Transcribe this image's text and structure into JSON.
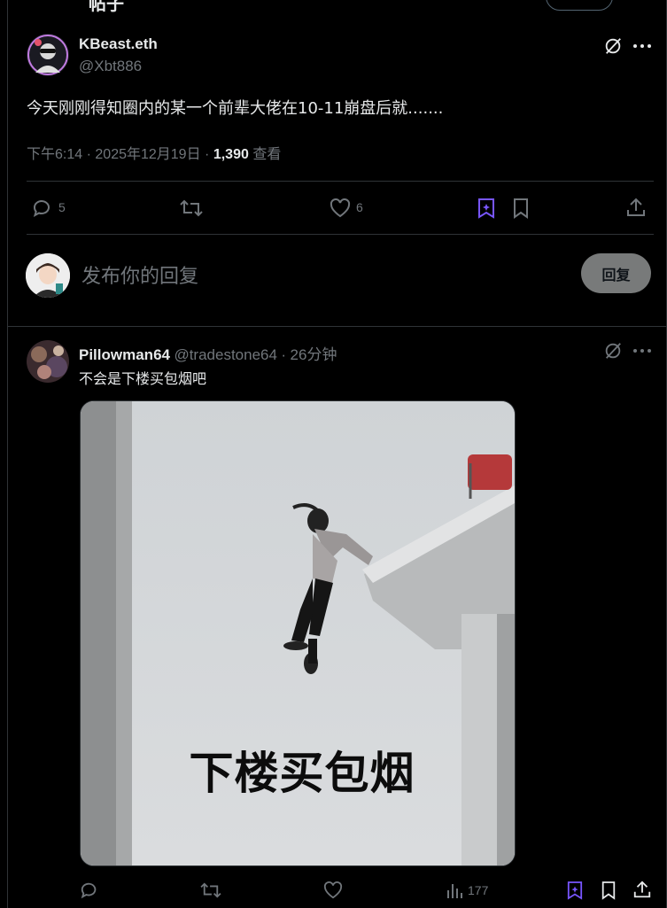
{
  "top_partial": {
    "text": "帖子"
  },
  "main_post": {
    "author_name": "KBeast.eth",
    "author_handle": "@Xbt886",
    "text": "今天刚刚得知圈内的某一个前辈大佬在10-11崩盘后就.......",
    "time": "下午6:14",
    "date": "2025年12月19日",
    "views": "1,390",
    "views_label": "查看",
    "replies_count": "5",
    "likes_count": "6",
    "icons": [
      "grok-icon",
      "more-icon",
      "reply-icon",
      "retweet-icon",
      "like-icon",
      "grok-sparkle-icon",
      "bookmark-icon",
      "share-icon"
    ]
  },
  "composer": {
    "placeholder": "发布你的回复",
    "button_label": "回复"
  },
  "reply_post": {
    "author_name": "Pillowman64",
    "author_handle": "@tradestone64",
    "time_ago": "26分钟",
    "text": "不会是下楼买包烟吧",
    "image_caption": "下楼买包烟",
    "views_count": "177"
  },
  "colors": {
    "background": "#000000",
    "text_primary": "#e7e9ea",
    "text_secondary": "#71767b",
    "border": "#2f3336",
    "accent": "#7856ff",
    "button_bg": "#787a7a"
  }
}
